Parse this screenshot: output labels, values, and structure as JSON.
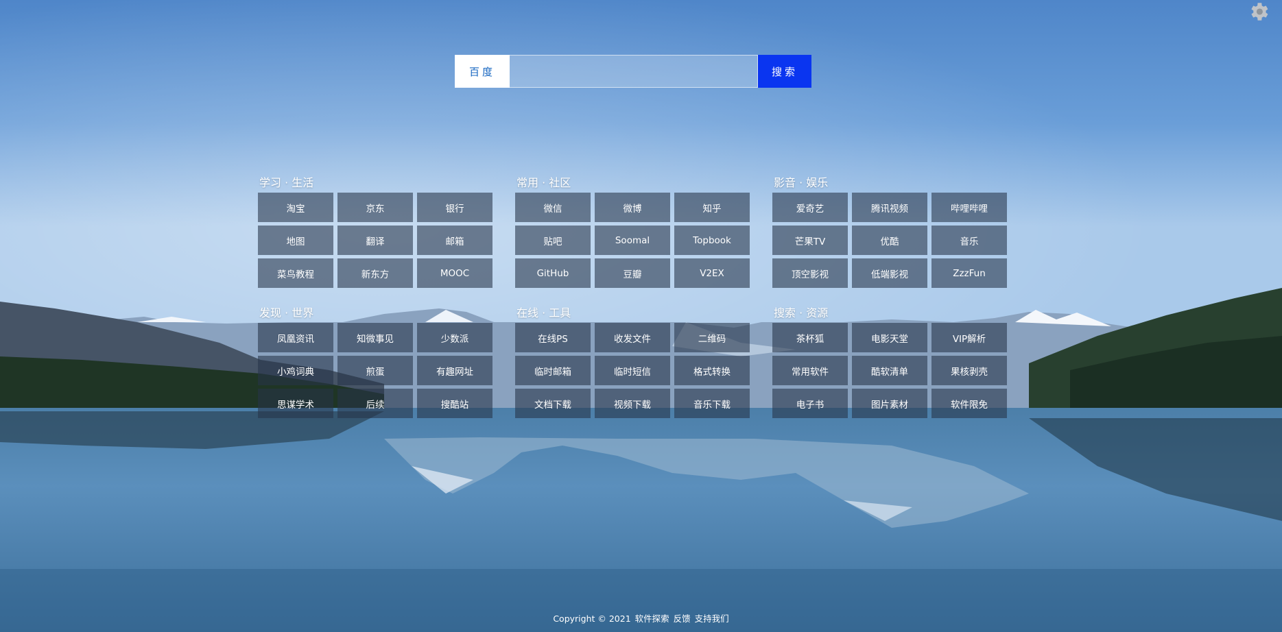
{
  "search": {
    "engine_label": "百度",
    "placeholder": "",
    "value": "",
    "button_label": "搜索"
  },
  "groups": [
    {
      "title": "学习 · 生活",
      "links": [
        "淘宝",
        "京东",
        "银行",
        "地图",
        "翻译",
        "邮箱",
        "菜鸟教程",
        "新东方",
        "MOOC"
      ]
    },
    {
      "title": "常用 · 社区",
      "links": [
        "微信",
        "微博",
        "知乎",
        "贴吧",
        "Soomal",
        "Topbook",
        "GitHub",
        "豆瓣",
        "V2EX"
      ]
    },
    {
      "title": "影音 · 娱乐",
      "links": [
        "爱奇艺",
        "腾讯视频",
        "哔哩哔哩",
        "芒果TV",
        "优酷",
        "音乐",
        "顶空影视",
        "低端影视",
        "ZzzFun"
      ]
    },
    {
      "title": "发现 · 世界",
      "links": [
        "凤凰资讯",
        "知微事见",
        "少数派",
        "小鸡词典",
        "煎蛋",
        "有趣网址",
        "思谋学术",
        "后续",
        "搜酷站"
      ]
    },
    {
      "title": "在线 · 工具",
      "links": [
        "在线PS",
        "收发文件",
        "二维码",
        "临时邮箱",
        "临时短信",
        "格式转换",
        "文档下载",
        "视频下载",
        "音乐下载"
      ]
    },
    {
      "title": "搜索 · 资源",
      "links": [
        "茶杯狐",
        "电影天堂",
        "VIP解析",
        "常用软件",
        "酷软清单",
        "果核剥壳",
        "电子书",
        "图片素材",
        "软件限免"
      ]
    }
  ],
  "footer": {
    "copyright": "Copyright © 2021",
    "links": [
      "软件探索",
      "反馈",
      "支持我们"
    ]
  },
  "icons": {
    "settings": "gear-icon"
  },
  "colors": {
    "search_button": "#0a35f0",
    "engine_text": "#1565c0",
    "tile_background": "rgba(38,52,72,0.58)"
  }
}
